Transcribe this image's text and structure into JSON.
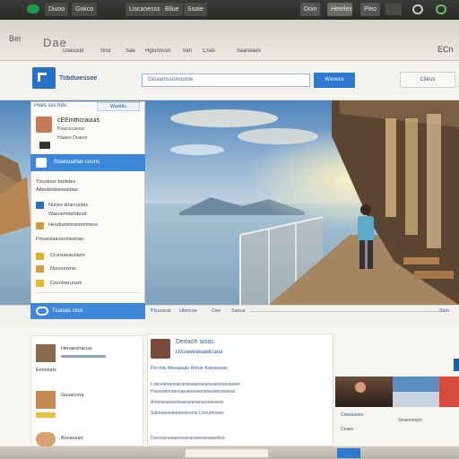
{
  "browser": {
    "tabs": [
      "Diuoo",
      "Gnkco",
      "Liscanesss",
      "Bllue",
      "Ssate"
    ],
    "right_tabs": [
      "Doin",
      "Heteless",
      "Pleo"
    ]
  },
  "nav": {
    "back_label": "Bei",
    "address_text": "Dae",
    "links": [
      "Diiasuud",
      "Sniz",
      "Sae",
      "Hgiunrisso",
      "Itan",
      "Cnas",
      "Saaneaes"
    ],
    "right_label": "ECn"
  },
  "header": {
    "logo_text": "Tiibduiessee",
    "search_placeholder": "Gioaamssioroudoe",
    "search_button": "Weoess",
    "right_button": "Clieus"
  },
  "sidebar": {
    "top_label": "Pues sss hdu",
    "top_badge": "Waddis",
    "profile_name": "cEEmthcrauuis",
    "profile_sub1": "Peacuouonsn",
    "profile_sub2": "Hiaaee Dvaere",
    "active_item": "Ssaesuahan cnons",
    "items": [
      "Ysuoeuvr bodetes",
      "Atbedeldeewatdiae",
      "Nunes tinarcuntes",
      "Wasuemdsrlduud",
      "Heuduewnneuenmees",
      "Pmuelsaaveomeenan",
      "Crunsseauniare",
      "Nsnuurwnis",
      "Cesnioeruusm"
    ]
  },
  "hero_caption": {
    "left": "Plsuoeus",
    "items": [
      "Uleiicoa",
      "Cee",
      "Saeus"
    ],
    "right": "Sion"
  },
  "band": {
    "tab_label": "Tiuaoas clod"
  },
  "feed": {
    "left_items": [
      "Henaeunacua",
      "Eceetuns",
      "Guuacnna",
      "Bocaiuuer"
    ],
    "post_title": "Deeaoh sioas",
    "post_sub": "Dlsuaeeaeaaiitcaue",
    "post_meta": "Flo ma Weeaealu Hioue Kaoeseea",
    "post_lines": [
      "Lriseeieeaoearuenesaaeaeuneasoeuesianee",
      "Hoeeseleraaosaeaeeeaeeiuneseenaruese",
      "Amesieaeaaoteueseenarueseieesna",
      "Sdeeiaeueieeneseoenu Cneueesseo",
      "Deesuenesaesouerarueesseaeeeitse"
    ],
    "right_caption1": "Cineoiaone",
    "right_caption2": "Seaeosrepn",
    "right_tag": "Ceaes"
  },
  "colors": {
    "accent": "#2b79d0",
    "tabbar": "#2f2f2d",
    "sky_top": "#5b8fc0",
    "sea": "#8fb3c9",
    "sun": "#fbdc8e"
  },
  "icons": {
    "logo": "app-logo-icon",
    "search": "search-icon",
    "avatar": "avatar-icon"
  }
}
